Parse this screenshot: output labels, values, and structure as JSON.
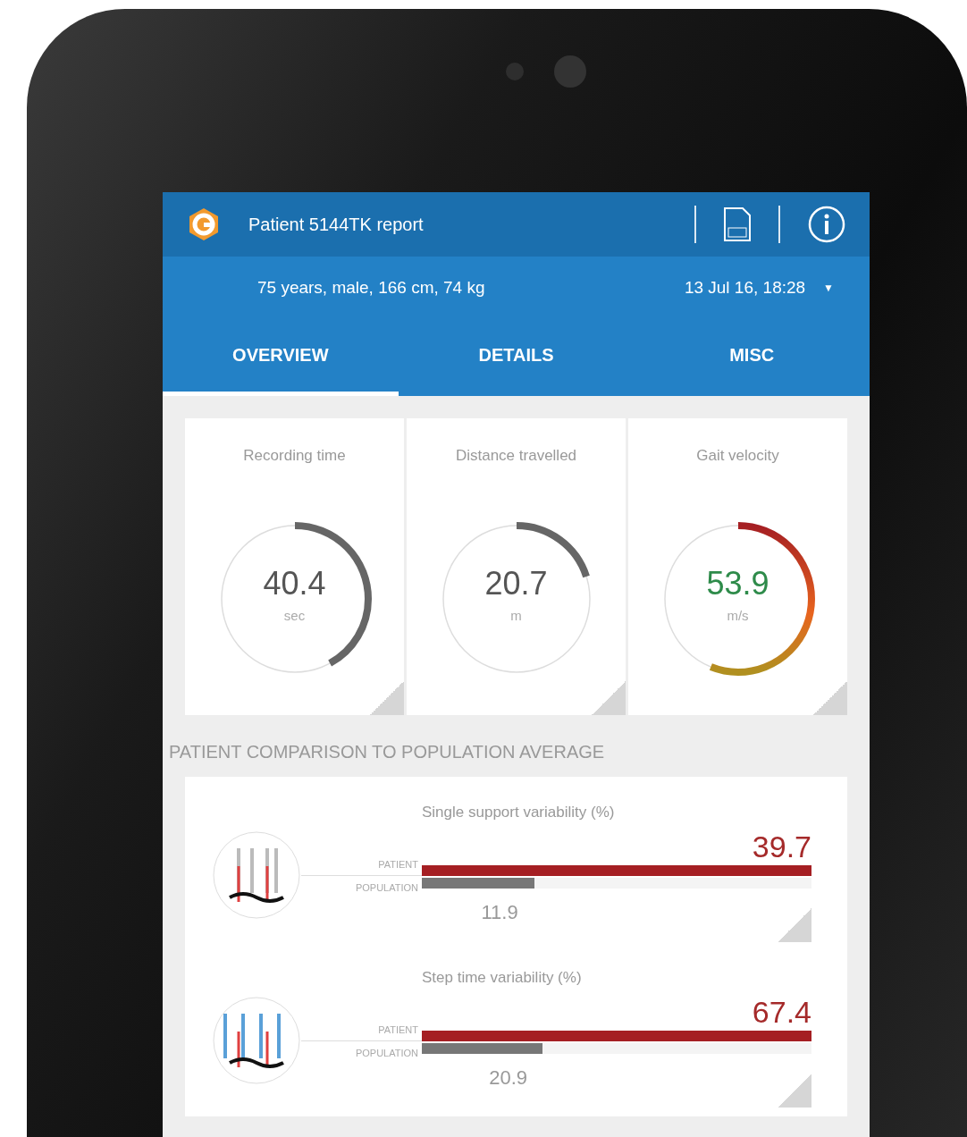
{
  "header": {
    "title": "Patient 5144TK report"
  },
  "subheader": {
    "patient_info": "75 years, male, 166 cm, 74 kg",
    "date": "13 Jul 16, 18:28",
    "dropdown_arrow": "▼"
  },
  "tabs": [
    {
      "label": "OVERVIEW",
      "selected": true
    },
    {
      "label": "DETAILS",
      "selected": false
    },
    {
      "label": "MISC",
      "selected": false
    }
  ],
  "metrics": [
    {
      "title": "Recording time",
      "value": "40.4",
      "unit": "sec",
      "level": 0.42,
      "kind": "plain"
    },
    {
      "title": "Distance travelled",
      "value": "20.7",
      "unit": "m",
      "level": 0.2,
      "kind": "plain"
    },
    {
      "title": "Gait velocity",
      "value": "53.9",
      "unit": "m/s",
      "level": 0.56,
      "kind": "rated"
    }
  ],
  "comparison": {
    "title": "PATIENT COMPARISON TO POPULATION AVERAGE",
    "items": [
      {
        "title": "Single support variability (%)",
        "patient": {
          "label": "PATIENT",
          "value": "39.7",
          "level": 1
        },
        "population": {
          "label": "POPULATION",
          "value": "11.9",
          "level": 0.29
        }
      },
      {
        "title": "Step time variability (%)",
        "patient": {
          "label": "PATIENT",
          "value": "67.4",
          "level": 1
        },
        "population": {
          "label": "POPULATION",
          "value": "20.9",
          "level": 0.31
        }
      }
    ]
  }
}
